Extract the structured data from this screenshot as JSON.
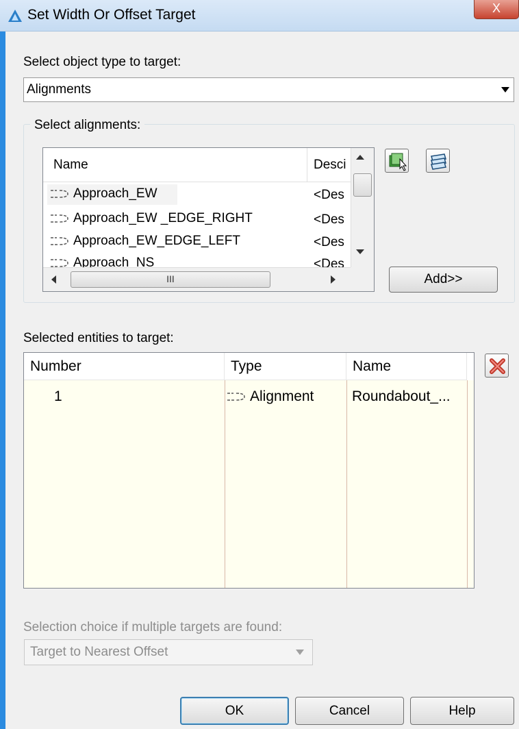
{
  "window": {
    "title": "Set Width Or Offset Target",
    "close_glyph": "X"
  },
  "object_type": {
    "label": "Select object type to target:",
    "value": "Alignments"
  },
  "alignments": {
    "group_label": "Select alignments:",
    "columns": [
      "Name",
      "Desci"
    ],
    "rows": [
      {
        "name": "Approach_EW",
        "desc": "<Des"
      },
      {
        "name": "Approach_EW _EDGE_RIGHT",
        "desc": "<Des"
      },
      {
        "name": "Approach_EW_EDGE_LEFT",
        "desc": "<Des"
      },
      {
        "name": "Approach_NS",
        "desc": "<Des"
      }
    ],
    "hscroll_grip": "III",
    "add_label": "Add>>"
  },
  "selected": {
    "label": "Selected entities to target:",
    "columns": [
      "Number",
      "Type",
      "Name"
    ],
    "rows": [
      {
        "number": "1",
        "type": "Alignment",
        "name": "Roundabout_..."
      }
    ]
  },
  "selection_choice": {
    "label": "Selection choice if multiple targets are found:",
    "value": "Target to Nearest Offset"
  },
  "buttons": {
    "ok": "OK",
    "cancel": "Cancel",
    "help": "Help"
  }
}
